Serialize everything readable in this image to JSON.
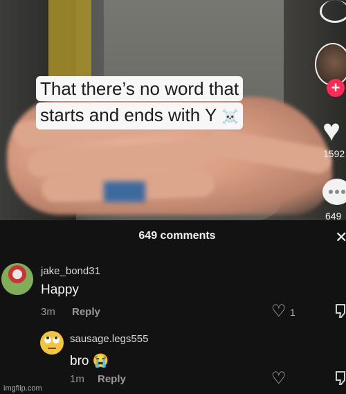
{
  "video": {
    "caption_line1": "That there’s no word that",
    "caption_line2": "starts and ends with Y",
    "caption_emoji": "☠️",
    "likes": "1592",
    "comments_count_side": "649"
  },
  "comments_panel": {
    "title": "649 comments",
    "close_icon": "close-icon",
    "comments": [
      {
        "username": "jake_bond31",
        "text": "Happy",
        "time": "3m",
        "reply_label": "Reply",
        "likes": "1"
      },
      {
        "username": "sausage.legs555",
        "text": "bro",
        "emoji": "😭",
        "time": "1m",
        "reply_label": "Reply"
      }
    ]
  },
  "watermark": "imgflip.com",
  "colors": {
    "follow": "#ff2b55",
    "panel_bg": "#121212"
  }
}
